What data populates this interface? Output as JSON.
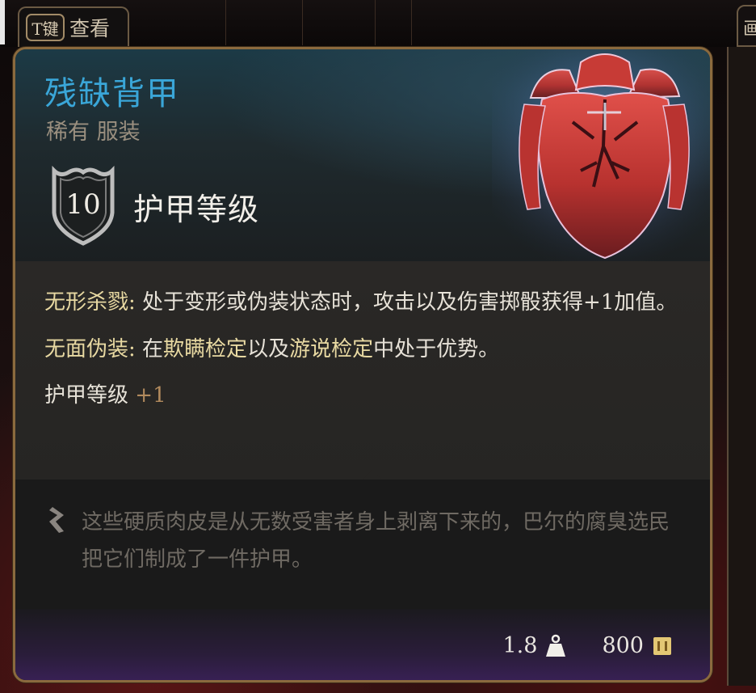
{
  "top_bar": {
    "key": "T键",
    "action": "查看",
    "right_tab_char": "画"
  },
  "item": {
    "name": "残缺背甲",
    "rarity_type": "稀有 服装",
    "armor_class_value": "10",
    "armor_class_label": "护甲等级",
    "name_color": "#3aa6d8"
  },
  "properties": [
    {
      "name": "无形杀戮:",
      "description": "处于变形或伪装状态时，攻击以及伤害掷骰获得+1加值。"
    },
    {
      "name": "无面伪装:",
      "description_parts": [
        "在",
        "欺瞒检定",
        "以及",
        "游说检定",
        "中处于优势。"
      ]
    }
  ],
  "bonus": {
    "label": "护甲等级",
    "value": "+1"
  },
  "lore": {
    "icon": "quill-icon",
    "text": "这些硬质肉皮是从无数受害者身上剥离下来的，巴尔的腐臭选民把它们制成了一件护甲。"
  },
  "footer": {
    "weight": "1.8",
    "weight_icon": "weight-icon",
    "value": "800",
    "value_icon": "gold-coin-icon"
  }
}
